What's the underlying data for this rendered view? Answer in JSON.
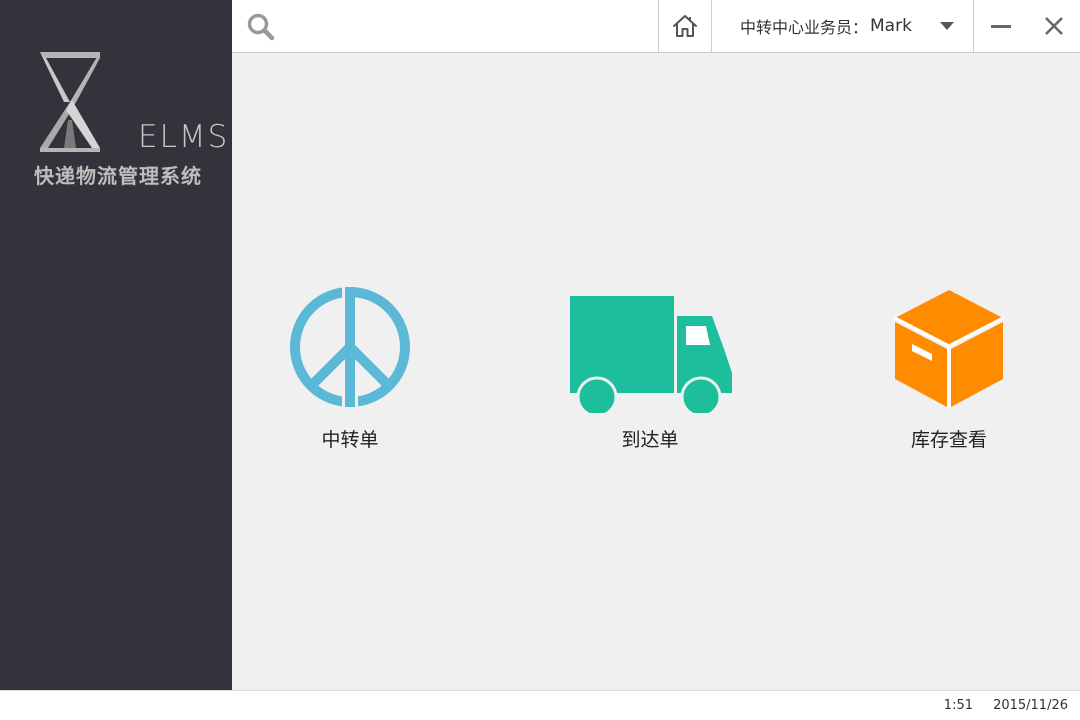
{
  "sidebar": {
    "logo_text": "ELMS",
    "app_subtitle": "快递物流管理系统"
  },
  "topbar": {
    "search": {
      "value": "",
      "placeholder": ""
    },
    "home_icon": "home-icon",
    "user": {
      "role": "中转中心业务员：",
      "name": "Mark"
    },
    "minimize_icon": "minimize-icon",
    "close_icon": "close-icon"
  },
  "main": {
    "tiles": [
      {
        "label": "中转单",
        "icon": "peace-sign-icon",
        "color": "#5bb8d6"
      },
      {
        "label": "到达单",
        "icon": "truck-icon",
        "color": "#1dbe9b"
      },
      {
        "label": "库存查看",
        "icon": "box-icon",
        "color": "#ff8c00"
      }
    ]
  },
  "statusbar": {
    "time": "1:51",
    "date": "2015/11/26"
  },
  "colors": {
    "sidebar_bg": "#33333b",
    "main_bg": "#f0f0f0"
  }
}
